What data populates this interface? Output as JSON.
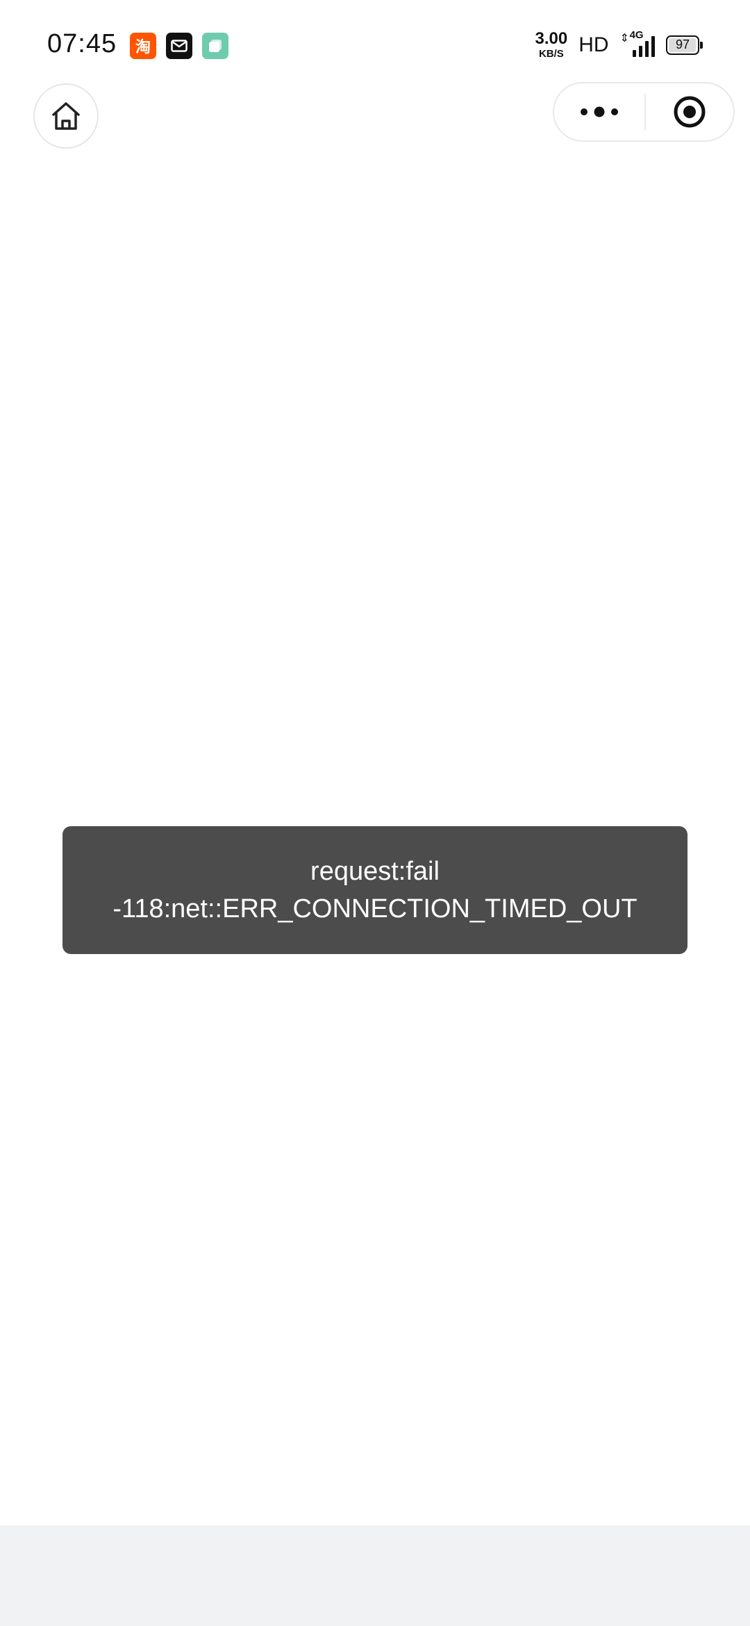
{
  "status_bar": {
    "time": "07:45",
    "notifications": [
      {
        "icon": "taobao-icon",
        "glyph": "淘"
      },
      {
        "icon": "mail-icon"
      },
      {
        "icon": "app-icon"
      }
    ],
    "net_speed_value": "3.00",
    "net_speed_unit": "KB/S",
    "hd_label": "HD",
    "network_type": "4G",
    "battery_level": "97",
    "battery_fraction": 0.97
  },
  "nav": {
    "home_icon": "home-icon",
    "more_icon": "more-dots-icon",
    "close_icon": "target-close-icon"
  },
  "toast": {
    "line1": "request:fail",
    "line2": "-118:net::ERR_CONNECTION_TIMED_OUT"
  },
  "colors": {
    "toast_bg": "#4c4c4c",
    "bottom_bg": "#f1f2f4",
    "taobao": "#ff5500"
  }
}
